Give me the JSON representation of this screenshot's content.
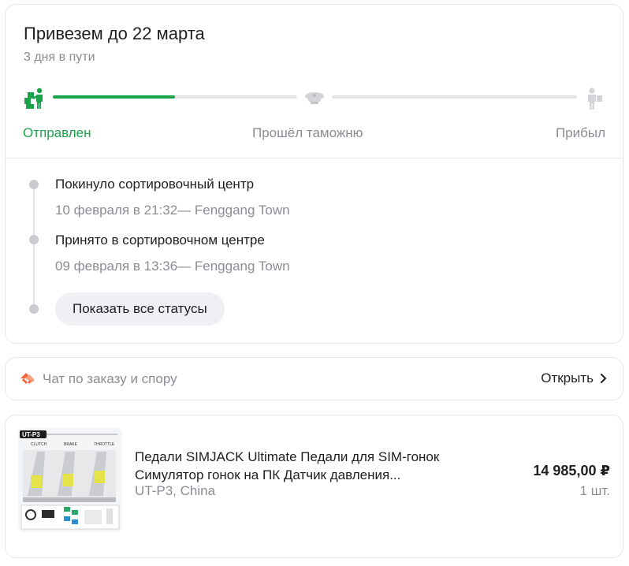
{
  "delivery": {
    "title": "Привезем до 22 марта",
    "subtitle": "3 дня в пути",
    "stages": [
      {
        "label": "Отправлен",
        "icon": "courier-boxes-icon",
        "state": "done"
      },
      {
        "label": "Прошёл таможню",
        "icon": "customs-cap-icon",
        "state": "pending"
      },
      {
        "label": "Прибыл",
        "icon": "recipient-icon",
        "state": "pending"
      }
    ],
    "progress_first_segment": 0.5,
    "events": [
      {
        "title": "Покинуло сортировочный центр",
        "meta": "10 февраля в 21:32— Fenggang Town"
      },
      {
        "title": "Принято в сортировочном центре",
        "meta": "09 февраля в 13:36— Fenggang Town"
      }
    ],
    "show_all_label": "Показать все статусы"
  },
  "chat": {
    "label": "Чат по заказу и спору",
    "open_label": "Открыть",
    "icon": "handshake-icon"
  },
  "product": {
    "name": "Педали SIMJACK Ultimate Педали для SIM-гонок Симулятор гонок на ПК Датчик давления...",
    "variant": "UT-P3, China",
    "price": "14 985,00 ₽",
    "quantity": "1 шт.",
    "image_labels": {
      "model": "UT-P3",
      "pedal1": "CLUTCH",
      "pedal2": "BRAKE",
      "pedal3": "THROTTLE"
    }
  },
  "colors": {
    "accent_green": "#1aa34a",
    "muted_text": "#8a8d93",
    "track_gray": "#e3e4e7",
    "chat_icon_orange": "#f0643c"
  }
}
